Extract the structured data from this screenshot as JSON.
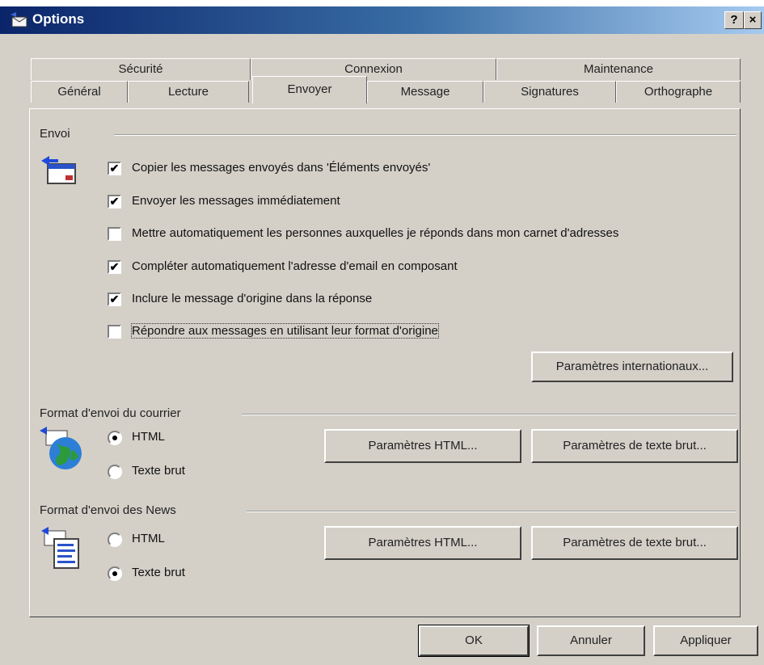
{
  "window": {
    "title": "Options"
  },
  "titlebar_buttons": {
    "help": "?",
    "close": "×"
  },
  "tabs_back": [
    "Sécurité",
    "Connexion",
    "Maintenance"
  ],
  "tabs_front": [
    "Général",
    "Lecture",
    "Envoyer",
    "Message",
    "Signatures",
    "Orthographe"
  ],
  "active_tab": "Envoyer",
  "envoi": {
    "label": "Envoi",
    "options": [
      {
        "label": "Copier les messages envoyés dans 'Éléments envoyés'",
        "checked": true,
        "mark": "✔"
      },
      {
        "label": "Envoyer les messages immédiatement",
        "checked": true,
        "mark": "✔"
      },
      {
        "label": "Mettre automatiquement les personnes auxquelles je réponds dans mon carnet d'adresses",
        "checked": false,
        "mark": ""
      },
      {
        "label": "Compléter automatiquement l'adresse d'email en composant",
        "checked": true,
        "mark": "✔"
      },
      {
        "label": "Inclure le message d'origine dans la réponse",
        "checked": true,
        "mark": "✔"
      },
      {
        "label": "Répondre aux messages en utilisant leur format d'origine",
        "checked": false,
        "mark": ""
      }
    ],
    "intl_button": "Paramètres internationaux..."
  },
  "mail_format": {
    "label": "Format d'envoi du courrier",
    "radio_html": "HTML",
    "radio_text": "Texte brut",
    "selected": "HTML",
    "html_settings_button": "Paramètres HTML...",
    "text_settings_button": "Paramètres de texte brut..."
  },
  "news_format": {
    "label": "Format d'envoi des News",
    "radio_html": "HTML",
    "radio_text": "Texte brut",
    "selected": "Texte brut",
    "html_settings_button": "Paramètres HTML...",
    "text_settings_button": "Paramètres de texte brut..."
  },
  "footer": {
    "ok": "OK",
    "cancel": "Annuler",
    "apply": "Appliquer"
  }
}
